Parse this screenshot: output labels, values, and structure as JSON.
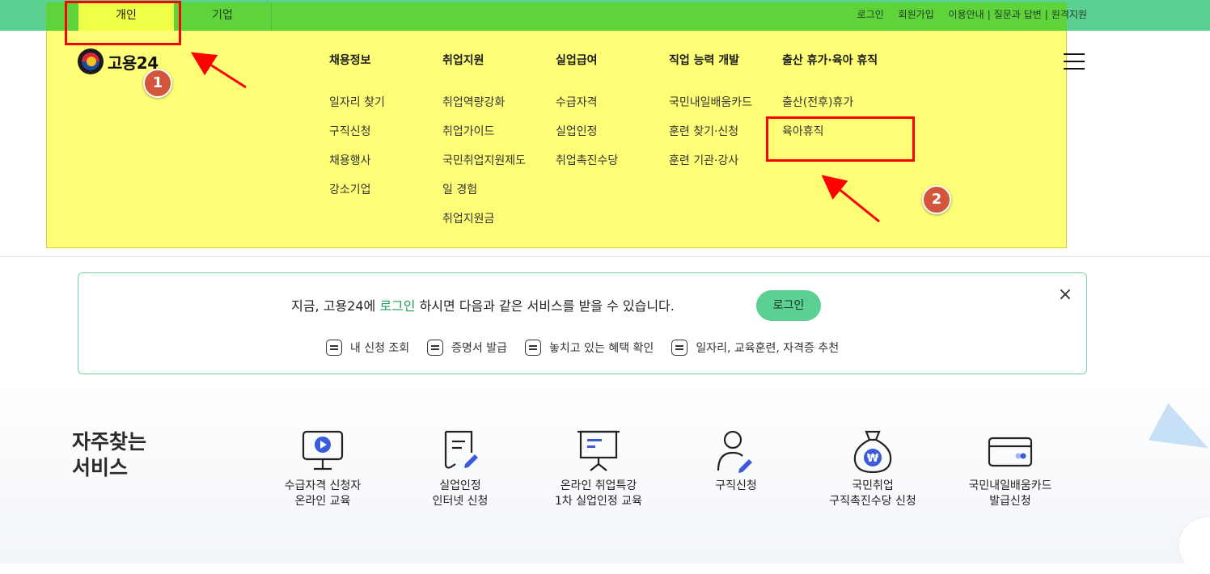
{
  "top_tabs": [
    {
      "label": "개인"
    },
    {
      "label": "기업"
    }
  ],
  "utility_links": {
    "login": "로그인",
    "signup": "회원가입",
    "guide": "이용안내",
    "qna": "질문과 답변",
    "remote": "원격지원",
    "separator": "|"
  },
  "logo": {
    "text": "고용24"
  },
  "menu": [
    {
      "heading": "채용정보",
      "items": [
        "일자리 찾기",
        "구직신청",
        "채용행사",
        "강소기업"
      ]
    },
    {
      "heading": "취업지원",
      "items": [
        "취업역량강화",
        "취업가이드",
        "국민취업지원제도",
        "일 경험",
        "취업지원금"
      ]
    },
    {
      "heading": "실업급여",
      "items": [
        "수급자격",
        "실업인정",
        "취업촉진수당"
      ]
    },
    {
      "heading": "직업 능력 개발",
      "items": [
        "국민내일배움카드",
        "훈련 찾기·신청",
        "훈련 기관·강사"
      ]
    },
    {
      "heading": "출산 휴가·육아 휴직",
      "items": [
        "출산(전후)휴가",
        "육아휴직"
      ]
    }
  ],
  "annotations": {
    "badge1": "1",
    "badge2": "2"
  },
  "login_banner": {
    "msg_pre": "지금, 고용24에 ",
    "msg_link": "로그인",
    "msg_post": " 하시면 다음과 같은 서비스를 받을 수 있습니다.",
    "button": "로그인",
    "close": "×",
    "features": [
      "내 신청 조회",
      "증명서 발급",
      "놓치고 있는 혜택 확인",
      "일자리, 교육훈련, 자격증 추천"
    ]
  },
  "frequent": {
    "title_line1": "자주찾는",
    "title_line2": "서비스",
    "services": [
      {
        "line1": "수급자격 신청자",
        "line2": "온라인 교육",
        "icon": "monitor-play-icon"
      },
      {
        "line1": "실업인정",
        "line2": "인터넷 신청",
        "icon": "document-pen-icon"
      },
      {
        "line1": "온라인 취업특강",
        "line2": "1차 실업인정 교육",
        "icon": "presentation-board-icon"
      },
      {
        "line1": "구직신청",
        "line2": "",
        "icon": "person-pen-icon"
      },
      {
        "line1": "국민취업",
        "line2": "구직촉진수당 신청",
        "icon": "money-bag-icon"
      },
      {
        "line1": "국민내일배움카드",
        "line2": "발급신청",
        "icon": "card-icon"
      }
    ]
  },
  "colors": {
    "accent_green": "#5ccf92",
    "highlight_yellow": "#ffff77",
    "annotation_red": "#ff0000",
    "link_green": "#1f9d55"
  }
}
